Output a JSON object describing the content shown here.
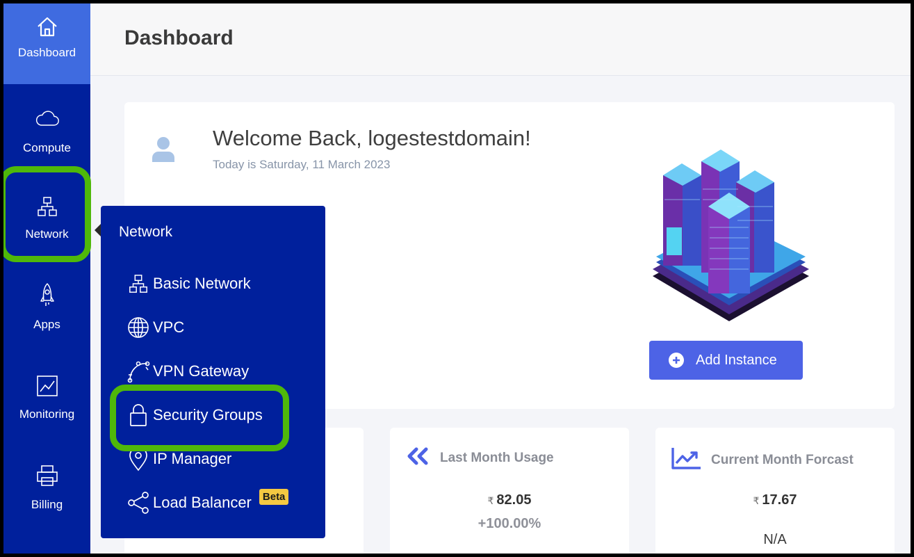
{
  "sidebar": {
    "items": [
      {
        "label": "Dashboard",
        "icon": "home-icon"
      },
      {
        "label": "Compute",
        "icon": "cloud-icon"
      },
      {
        "label": "Network",
        "icon": "network-icon"
      },
      {
        "label": "Apps",
        "icon": "rocket-icon"
      },
      {
        "label": "Monitoring",
        "icon": "chart-icon"
      },
      {
        "label": "Billing",
        "icon": "printer-icon"
      }
    ]
  },
  "header": {
    "title": "Dashboard"
  },
  "welcome": {
    "title": "Welcome Back, logestestdomain!",
    "date": "Today is Saturday, 11 March 2023",
    "add_button": "Add Instance"
  },
  "stats": {
    "last_month": {
      "title": "Last Month Usage",
      "currency": "₹",
      "amount": "82.05",
      "change": "+100.00%"
    },
    "forecast": {
      "title": "Current Month Forcast",
      "currency": "₹",
      "amount": "17.67",
      "change": "N/A"
    }
  },
  "flyout": {
    "title": "Network",
    "items": [
      {
        "label": "Basic Network",
        "icon": "network-icon"
      },
      {
        "label": "VPC",
        "icon": "globe-icon"
      },
      {
        "label": "VPN Gateway",
        "icon": "vpn-icon"
      },
      {
        "label": "Security Groups",
        "icon": "lock-icon"
      },
      {
        "label": "IP Manager",
        "icon": "location-pin-icon"
      },
      {
        "label": "Load Balancer",
        "icon": "share-icon",
        "badge": "Beta"
      }
    ]
  },
  "colors": {
    "sidebar": "#00209c",
    "active": "#3f6be0",
    "button": "#4d63e6",
    "highlight": "#4fb80a",
    "badge": "#f5c842"
  }
}
